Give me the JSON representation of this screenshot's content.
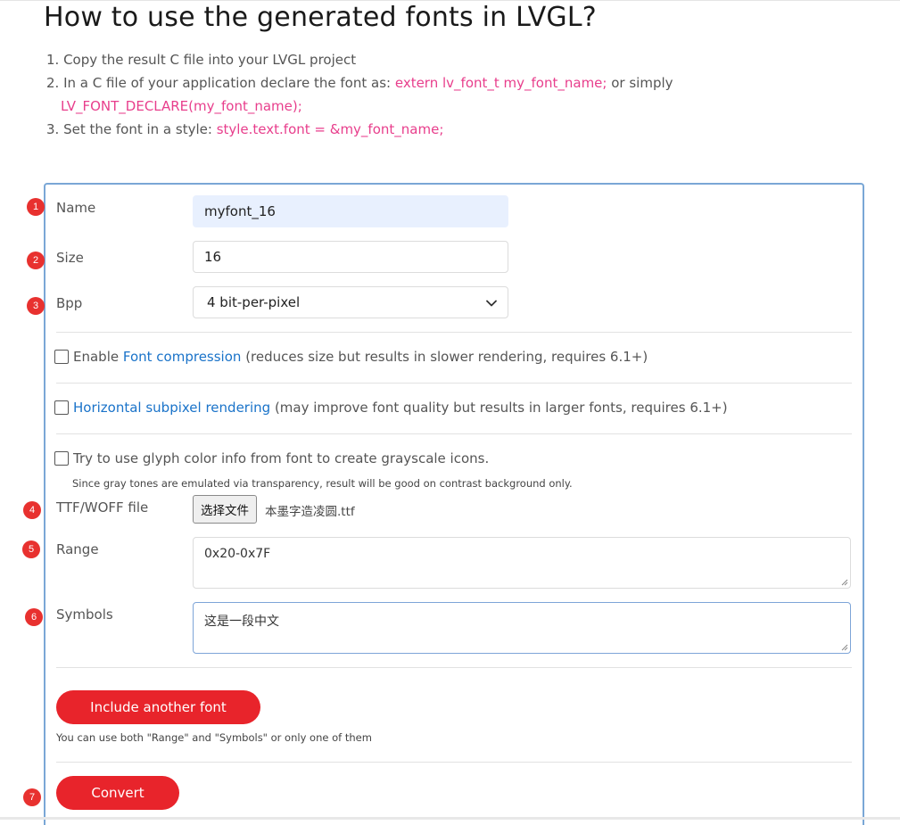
{
  "page": {
    "title": "How to use the generated fonts in LVGL?"
  },
  "steps": {
    "s1": "1. Copy the result C file into your LVGL project",
    "s2_prefix": "2. In a C file of your application declare the font as:",
    "s2_code1": "extern lv_font_t my_font_name;",
    "s2_mid": "or simply",
    "s2_code2": "LV_FONT_DECLARE(my_font_name);",
    "s3_prefix": "3. Set the font in a style:",
    "s3_code": "style.text.font = &my_font_name;"
  },
  "form": {
    "name_label": "Name",
    "name_value": "myfont_16",
    "size_label": "Size",
    "size_value": "16",
    "bpp_label": "Bpp",
    "bpp_value": "4 bit-per-pixel",
    "compression_prefix": "Enable",
    "compression_link": "Font compression",
    "compression_suffix": "(reduces size but results in slower rendering, requires 6.1+)",
    "subpixel_link": "Horizontal subpixel rendering",
    "subpixel_suffix": "(may improve font quality but results in larger fonts, requires 6.1+)",
    "glyph_color_label": "Try to use glyph color info from font to create grayscale icons.",
    "glyph_color_note": "Since gray tones are emulated via transparency, result will be good on contrast background only.",
    "file_label": "TTF/WOFF file",
    "file_button": "选择文件",
    "file_name": "本墨字造凌圆.ttf",
    "range_label": "Range",
    "range_value": "0x20-0x7F",
    "symbols_label": "Symbols",
    "symbols_value": "这是一段中文",
    "include_button": "Include another font",
    "include_note": "You can use both \"Range\" and \"Symbols\" or only one of them",
    "convert_button": "Convert"
  },
  "badges": [
    "1",
    "2",
    "3",
    "4",
    "5",
    "6",
    "7"
  ],
  "colors": {
    "accent_red": "#e8242b",
    "badge_red": "#e8312f",
    "code_pink": "#e83e8c",
    "link_blue": "#1a73c9",
    "panel_border": "#7aa7d6"
  }
}
